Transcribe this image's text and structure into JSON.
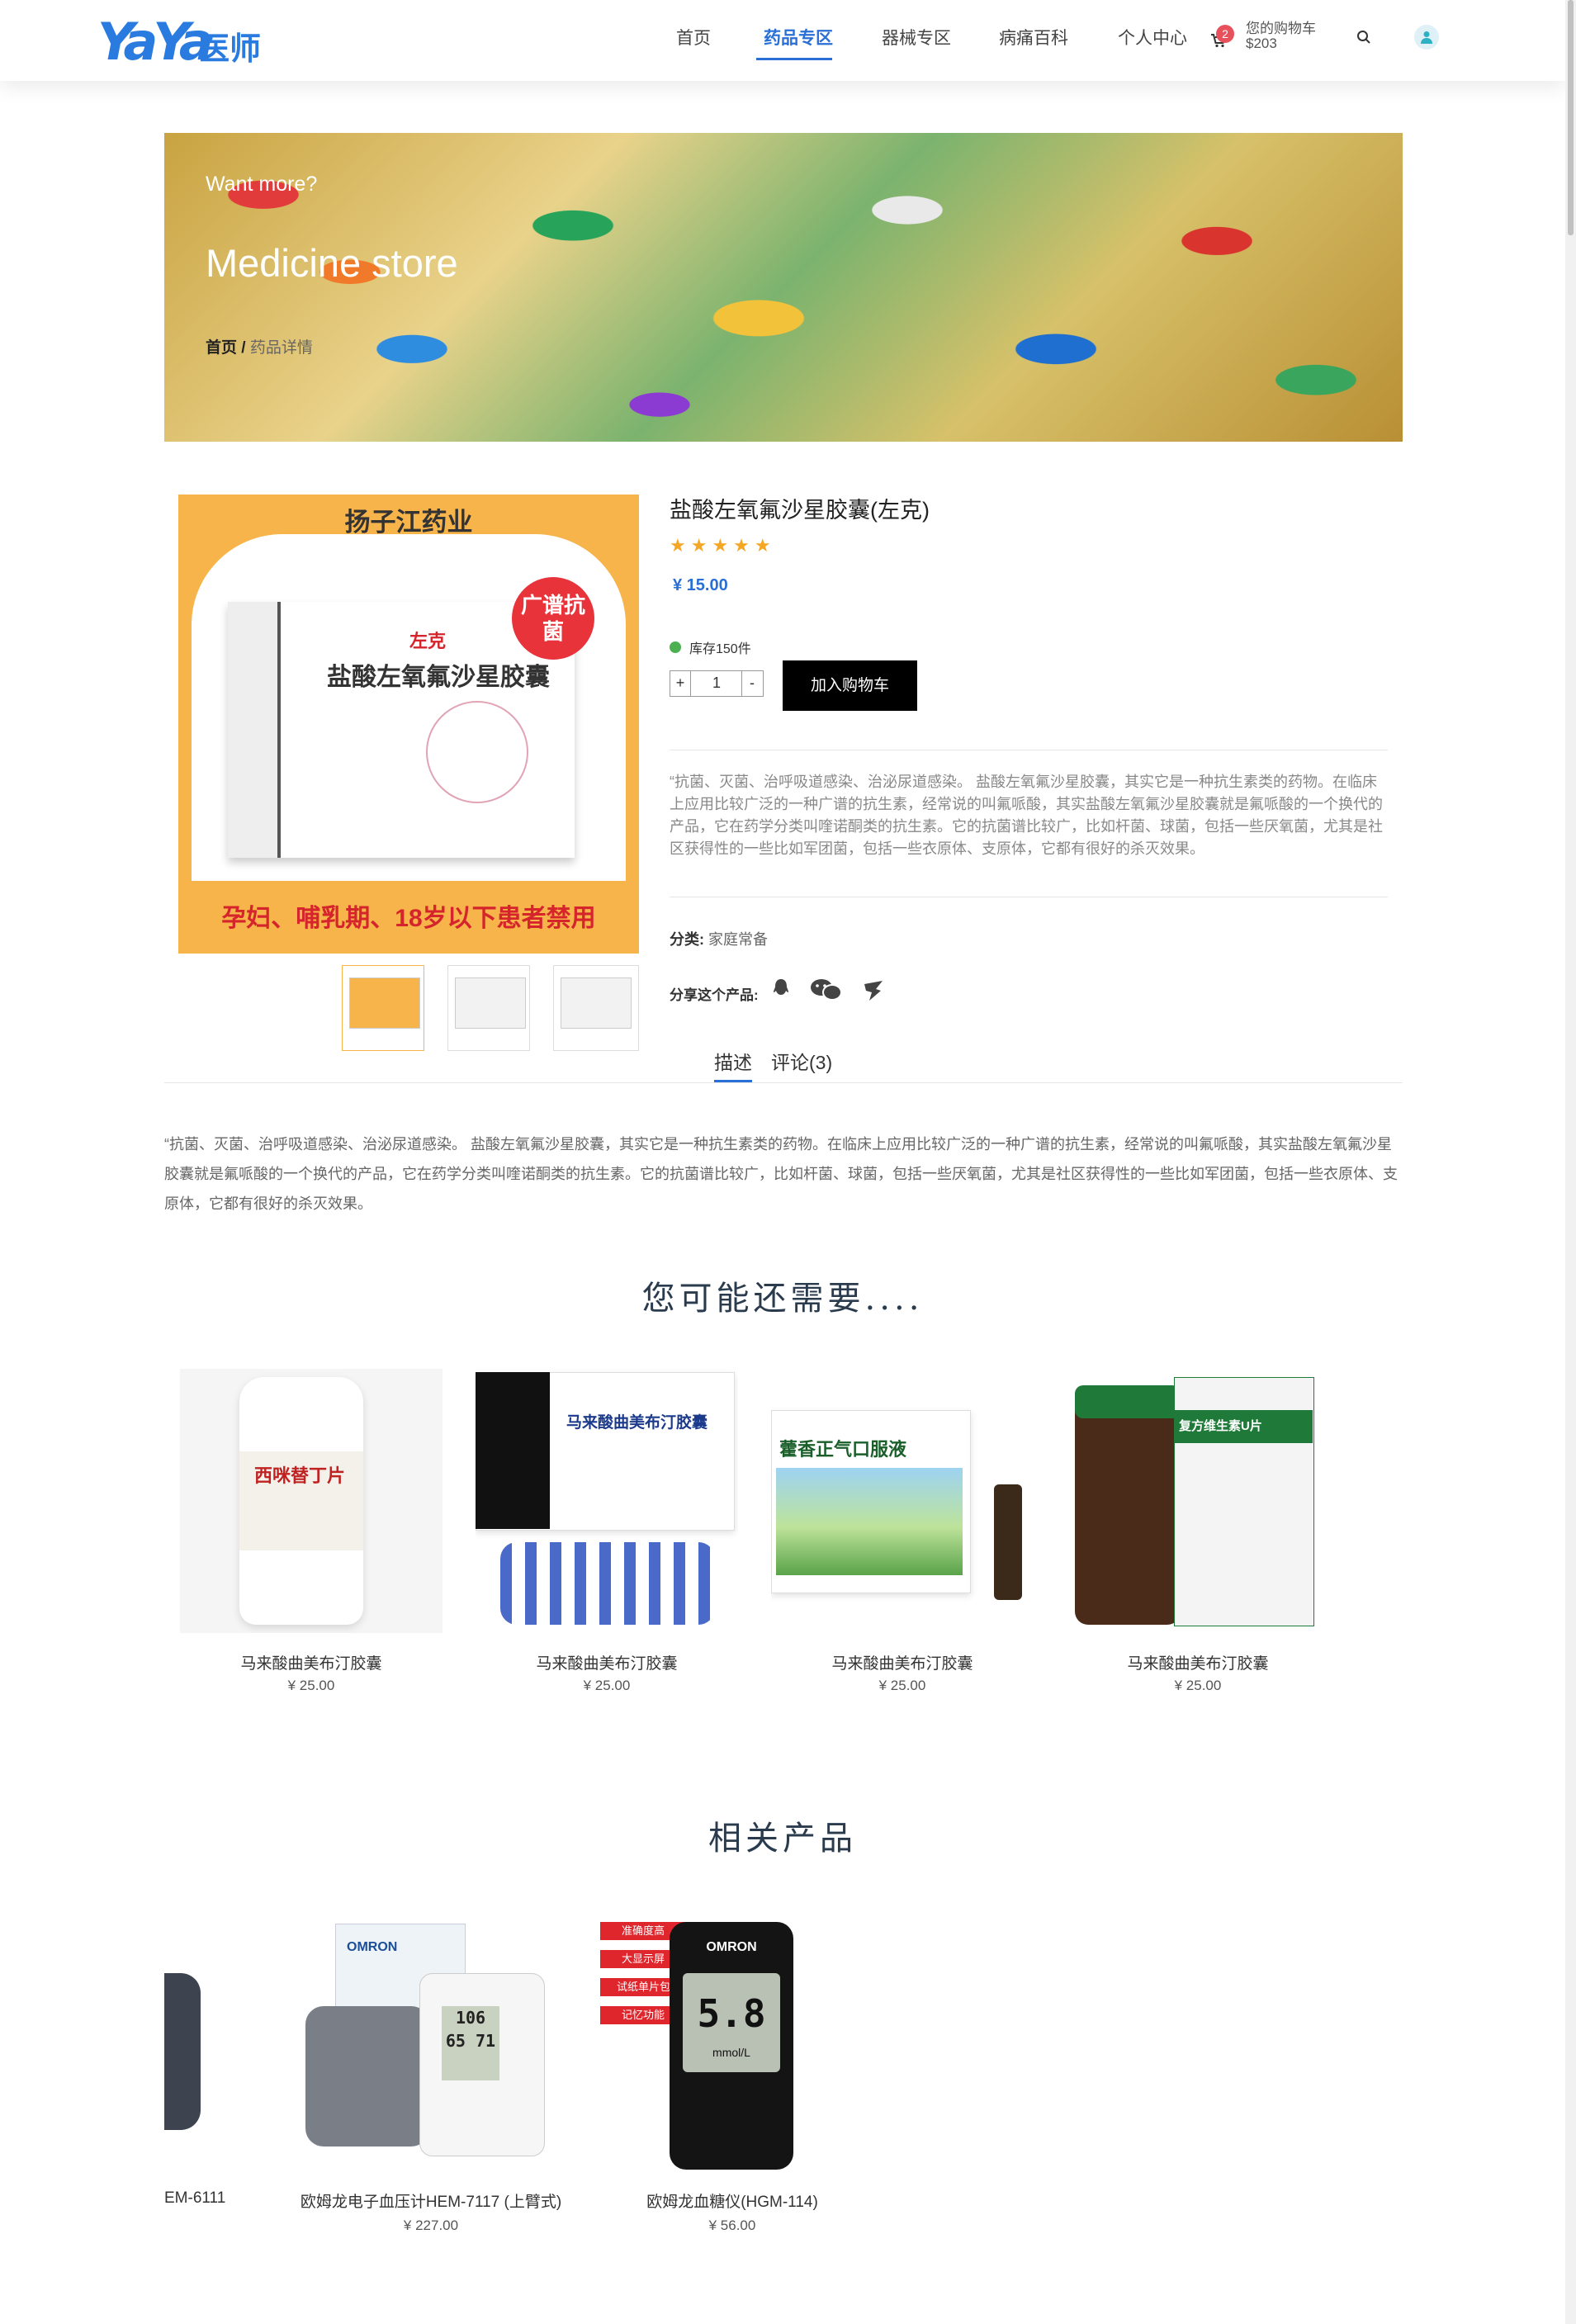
{
  "header": {
    "logo_latin": "YaYa",
    "logo_cn": "医师",
    "nav": [
      "首页",
      "药品专区",
      "器械专区",
      "病痛百科",
      "个人中心"
    ],
    "cart_count": "2",
    "cart_line1": "您的购物车",
    "cart_line2": "$203"
  },
  "banner": {
    "small": "Want more?",
    "big": "Medicine store",
    "crumb_home": "首页",
    "crumb_sep": "/",
    "crumb_current": "药品详情"
  },
  "product": {
    "image_title": "扬子江药业",
    "image_brand": "左克",
    "image_box_name": "盐酸左氧氟沙星胶囊",
    "image_badge": "广谱抗菌",
    "image_footer": "孕妇、哺乳期、18岁以下患者禁用",
    "title": "盐酸左氧氟沙星胶囊(左克)",
    "stars": "★★★★★",
    "rating": 5,
    "price": "¥ 15.00",
    "stock": "库存150件",
    "qty_minus": "+",
    "qty_value": "1",
    "qty_plus": "-",
    "add_to_cart": "加入购物车",
    "short_description": "“抗菌、灭菌、治呼吸道感染、治泌尿道感染。 盐酸左氧氟沙星胶囊，其实它是一种抗生素类的药物。在临床上应用比较广泛的一种广谱的抗生素，经常说的叫氟哌酸，其实盐酸左氧氟沙星胶囊就是氟哌酸的一个换代的产品，它在药学分类叫喹诺酮类的抗生素。它的抗菌谱比较广，比如杆菌、球菌，包括一些厌氧菌，尤其是社区获得性的一些比如军团菌，包括一些衣原体、支原体，它都有很好的杀灭效果。",
    "category_label": "分类:",
    "category_value": "家庭常备",
    "share_label": "分享这个产品:"
  },
  "tabs": [
    "描述",
    "评论(3)"
  ],
  "long_description": "“抗菌、灭菌、治呼吸道感染、治泌尿道感染。 盐酸左氧氟沙星胶囊，其实它是一种抗生素类的药物。在临床上应用比较广泛的一种广谱的抗生素，经常说的叫氟哌酸，其实盐酸左氧氟沙星胶囊就是氟哌酸的一个换代的产品，它在药学分类叫喹诺酮类的抗生素。它的抗菌谱比较广，比如杆菌、球菌，包括一些厌氧菌，尤其是社区获得性的一些比如军团菌，包括一些衣原体、支原体，它都有很好的杀灭效果。",
  "you_may_need": {
    "title": "您可能还需要....",
    "items": [
      {
        "name": "马来酸曲美布汀胶囊",
        "price": "¥ 25.00",
        "image_label": "西咪替丁片"
      },
      {
        "name": "马来酸曲美布汀胶囊",
        "price": "¥ 25.00",
        "image_label": "马来酸曲美布汀胶囊"
      },
      {
        "name": "马来酸曲美布汀胶囊",
        "price": "¥ 25.00",
        "image_label": "藿香正气口服液"
      },
      {
        "name": "马来酸曲美布汀胶囊",
        "price": "¥ 25.00",
        "image_label": "复方维生素U片"
      }
    ]
  },
  "related": {
    "title": "相关产品",
    "items": [
      {
        "name": "EM-6111",
        "price": ""
      },
      {
        "name": "欧姆龙电子血压计HEM-7117 (上臂式)",
        "price": "¥ 227.00",
        "image_label": "OMRON",
        "display": "106 65 71"
      },
      {
        "name": "欧姆龙血糖仪(HGM-114)",
        "price": "¥ 56.00",
        "image_label": "OMRON",
        "display": "5.8",
        "unit": "mmol/L",
        "tags": [
          "准确度高",
          "大显示屏",
          "试纸单片包装",
          "记忆功能"
        ]
      }
    ]
  }
}
